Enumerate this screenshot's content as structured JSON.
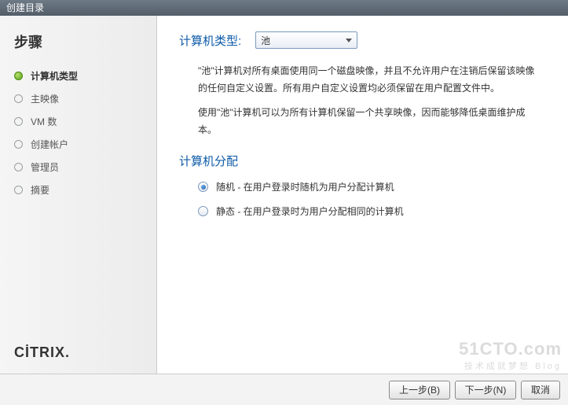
{
  "titlebar": {
    "title": "创建目录"
  },
  "sidebar": {
    "steps_title": "步骤",
    "items": [
      {
        "label": "计算机类型",
        "active": true
      },
      {
        "label": "主映像",
        "active": false
      },
      {
        "label": "VM 数",
        "active": false
      },
      {
        "label": "创建帐户",
        "active": false
      },
      {
        "label": "管理员",
        "active": false
      },
      {
        "label": "摘要",
        "active": false
      }
    ],
    "brand": "CİTRIX"
  },
  "content": {
    "type_label": "计算机类型:",
    "dropdown_value": "池",
    "desc1": "\"池\"计算机对所有桌面使用同一个磁盘映像，并且不允许用户在注销后保留该映像的任何自定义设置。所有用户自定义设置均必须保留在用户配置文件中。",
    "desc2": "使用\"池\"计算机可以为所有计算机保留一个共享映像，因而能够降低桌面维护成本。",
    "alloc_label": "计算机分配",
    "radios": [
      {
        "label": "随机 - 在用户登录时随机为用户分配计算机",
        "selected": true
      },
      {
        "label": "静态 - 在用户登录时为用户分配相同的计算机",
        "selected": false
      }
    ]
  },
  "footer": {
    "back": "上一步(B)",
    "next": "下一步(N)",
    "cancel": "取消"
  },
  "watermark": {
    "l1": "51CTO.com",
    "l2": "技术成就梦想 Blog"
  }
}
